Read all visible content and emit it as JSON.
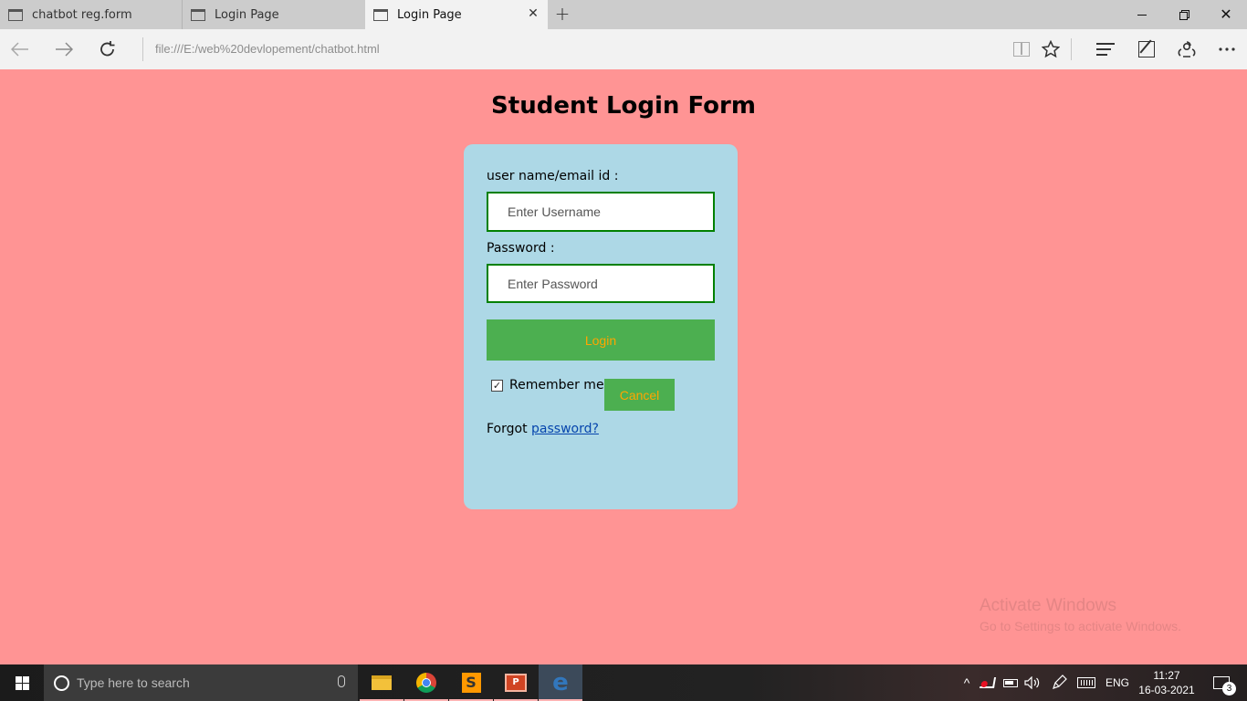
{
  "browser": {
    "tabs": [
      {
        "label": "chatbot reg.form",
        "active": false
      },
      {
        "label": "Login Page",
        "active": false
      },
      {
        "label": "Login Page",
        "active": true
      }
    ],
    "new_tab_glyph": "+",
    "close_tab_glyph": "✕",
    "url": "file:///E:/web%20devlopement/chatbot.html",
    "icons": {
      "back": "back-arrow-icon",
      "forward": "forward-arrow-icon",
      "refresh": "refresh-icon",
      "reading_view": "reading-view-icon",
      "favorite": "star-icon",
      "hub": "hub-icon",
      "web_note": "web-note-icon",
      "share": "share-icon",
      "more": "more-icon"
    }
  },
  "page": {
    "title": "Student Login Form",
    "username_label": "user name/email id :",
    "username_placeholder": "Enter Username",
    "password_label": "Password :",
    "password_placeholder": "Enter Password",
    "login_button": "Login",
    "remember_label": "Remember me",
    "remember_checked": true,
    "cancel_button": "Cancel",
    "forgot_text": "Forgot ",
    "forgot_link": "password?",
    "watermark_line1": "Activate Windows",
    "watermark_line2": "Go to Settings to activate Windows.",
    "colors": {
      "page_bg": "#ff9494",
      "card_bg": "#add8e6",
      "button_bg": "#4caf50",
      "button_text": "#ffa500",
      "input_border": "#008000"
    }
  },
  "taskbar": {
    "search_placeholder": "Type here to search",
    "apps": [
      "file-explorer-icon",
      "chrome-icon",
      "sublime-text-icon",
      "powerpoint-icon",
      "edge-icon"
    ],
    "sublime_glyph": "S",
    "ppt_glyph": "P",
    "edge_glyph": "e",
    "language": "ENG",
    "time": "11:27",
    "date": "16-03-2021",
    "notification_count": "3"
  }
}
